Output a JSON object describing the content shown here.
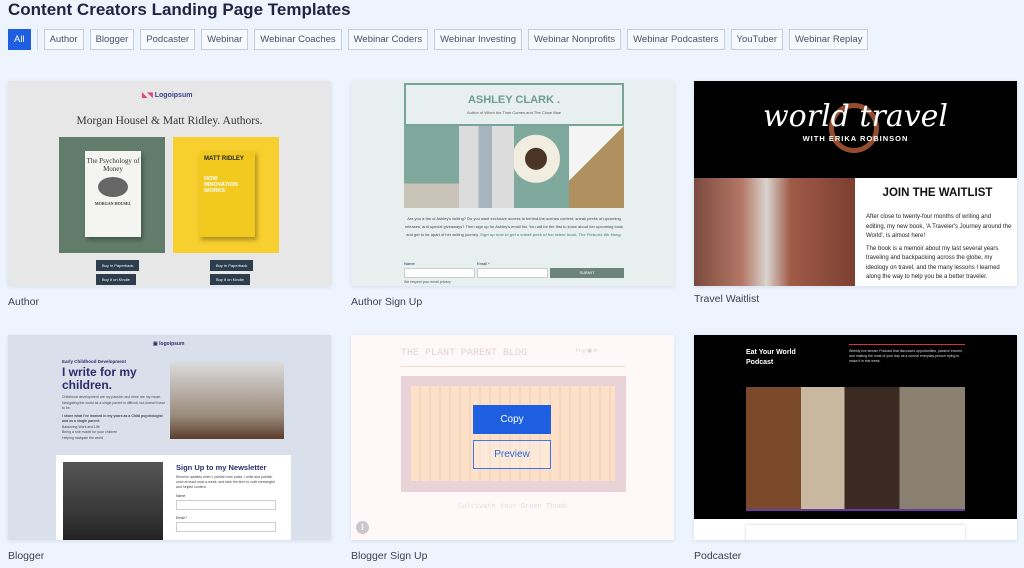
{
  "page": {
    "title": "Content Creators Landing Page Templates"
  },
  "filters": [
    {
      "label": "All",
      "active": true
    },
    {
      "label": "Author"
    },
    {
      "label": "Blogger"
    },
    {
      "label": "Podcaster"
    },
    {
      "label": "Webinar"
    },
    {
      "label": "Webinar Coaches"
    },
    {
      "label": "Webinar Coders"
    },
    {
      "label": "Webinar Investing"
    },
    {
      "label": "Webinar Nonprofits"
    },
    {
      "label": "Webinar Podcasters"
    },
    {
      "label": "YouTuber"
    },
    {
      "label": "Webinar Replay"
    }
  ],
  "templates": [
    {
      "name": "Author",
      "logo": "Logoipsum",
      "heading": "Morgan Housel & Matt Ridley. Authors.",
      "book1": "The Psychology of Money",
      "book1_author": "MORGAN HOUSEL",
      "book2": "HOW INNOVATION WORKS",
      "book2_author": "MATT RIDLEY",
      "btn1": "Buy in Paperback",
      "btn2": "Buy it on Kindle"
    },
    {
      "name": "Author Sign Up",
      "heading": "ASHLEY CLARK .",
      "subheading": "Author of When the Time Comes and The Close Mae",
      "body": "Are you a fan of Ashley's writing? Do you want exclusive access to behind-the-scenes content, sneak peeks of upcoming releases, and special giveaways? Then sign up for Ashley's email list. You will be the first to know about her upcoming book and get to be apart of her writing journey.",
      "link": "Sign up now to get a sneak peek of her latest book, The Pictures We Hang.",
      "name_label": "Name",
      "email_label": "Email *",
      "submit": "SUBMIT",
      "privacy": "We respect your email privacy"
    },
    {
      "name": "Travel Waitlist",
      "logo_title": "world travel",
      "logo_sub": "WITH ERIKA ROBINSON",
      "heading": "JOIN THE WAITLIST",
      "p1": "After close to twenty-four months of writing and editing, my new book, 'A Traveler's Journey around the World', is almost here!",
      "p2": "The book is a memoir about my last several years traveling and backpacking across the globe, my ideology on travel, and the many lessons I learned along the way to help you be a better traveler."
    },
    {
      "name": "Blogger",
      "logo": "logoipsum",
      "eyebrow": "Early Childhood Development",
      "heading": "I write for my children.",
      "body": "Childhood development are my passion and mine are my muse. Navigating the world as a single parent is difficult, but doesn't have to be.",
      "bold": "I share what I've learned in my years as a Child psychologist and as a single parent:",
      "bullets": [
        "Balancing Work and Life",
        "Being a role model for your children",
        "Helping navigate the world"
      ],
      "newsletter": "Sign Up to my Newsletter",
      "news_body": "Receive updates when I publish new posts. I write and publish once at least once a week, and take the time to craft meaningful and helpful content.",
      "name_label": "Name",
      "email_label": "Email *"
    },
    {
      "name": "Blogger Sign Up",
      "heading": "THE PLANT PARENT BLOG",
      "tagline": "Cultivate Your Green Thumb",
      "copy": "Copy",
      "preview": "Preview"
    },
    {
      "name": "Podcaster",
      "heading": "Eat Your World Podcast",
      "body": "Weekly live stream Podcast that discusses opportunities, passive income, and making the most of your day as a normal everyday person trying to make it in this week."
    }
  ],
  "colors": {
    "accent": "#1d5fe0",
    "background": "#eef4fd"
  }
}
